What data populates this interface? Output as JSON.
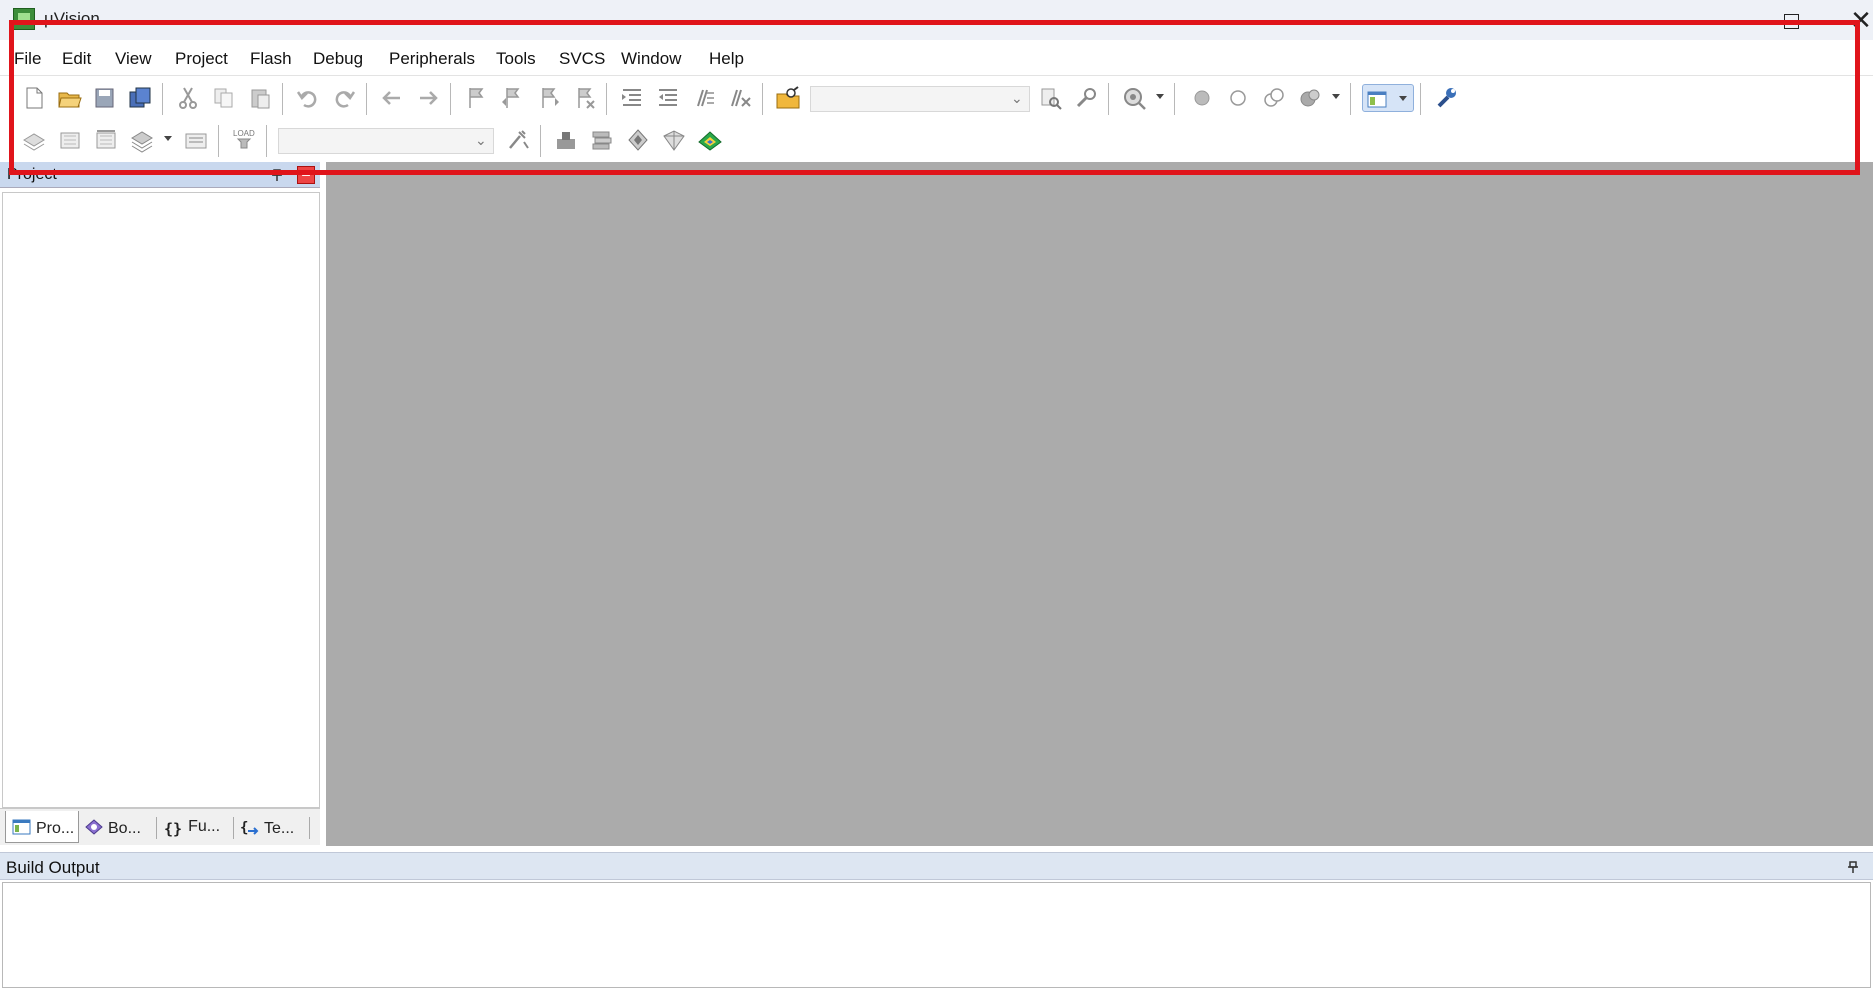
{
  "window": {
    "title": "µVision"
  },
  "menu": [
    "File",
    "Edit",
    "View",
    "Project",
    "Flash",
    "Debug",
    "Peripherals",
    "Tools",
    "SVCS",
    "Window",
    "Help"
  ],
  "toolbar1": {
    "target_combo_value": ""
  },
  "toolbar2": {
    "build_target_value": "",
    "load_label": "LOAD"
  },
  "project_panel": {
    "title": "Project",
    "tabs": [
      "Pro...",
      "Bo...",
      "Fu...",
      "Te..."
    ]
  },
  "build_output": {
    "title": "Build Output"
  },
  "colors": {
    "highlight": "#e0141b",
    "editor_bg": "#ababab",
    "pane_header": "#c9d8ee"
  }
}
